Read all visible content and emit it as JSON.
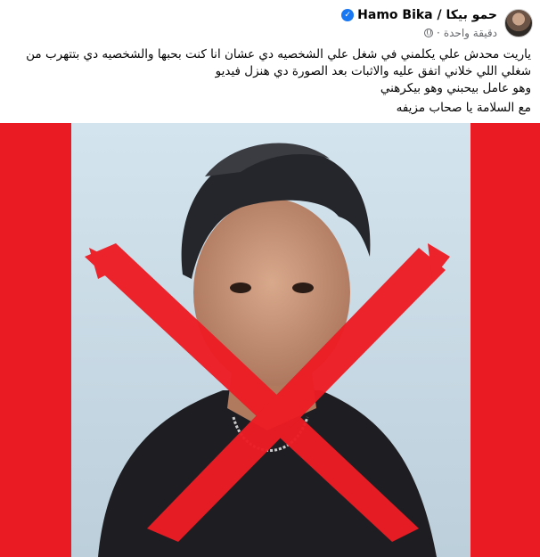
{
  "post": {
    "author": "حمو بيكا / Hamo Bika",
    "verified_icon": "verified-badge-icon",
    "timestamp": "دقيقة واحدة",
    "privacy_icon": "globe-icon",
    "text_lines": [
      "ياريت محدش علي يكلمني في شغل علي الشخصيه دي عشان انا كنت بحبها والشخصيه دي بتتهرب من",
      "شغلي اللي خلاني اتفق عليه والاثبات بعد الصورة دي هنزل فيديو",
      "وهو عامل بيحبني وهو بيكرهني",
      "مع السلامة يا صحاب مزيفه"
    ]
  },
  "colors": {
    "background_red": "#ea1b22",
    "cross_red": "#ee1c24",
    "photo_bg": "#c9dbe6",
    "link_blue": "#1877f2"
  }
}
